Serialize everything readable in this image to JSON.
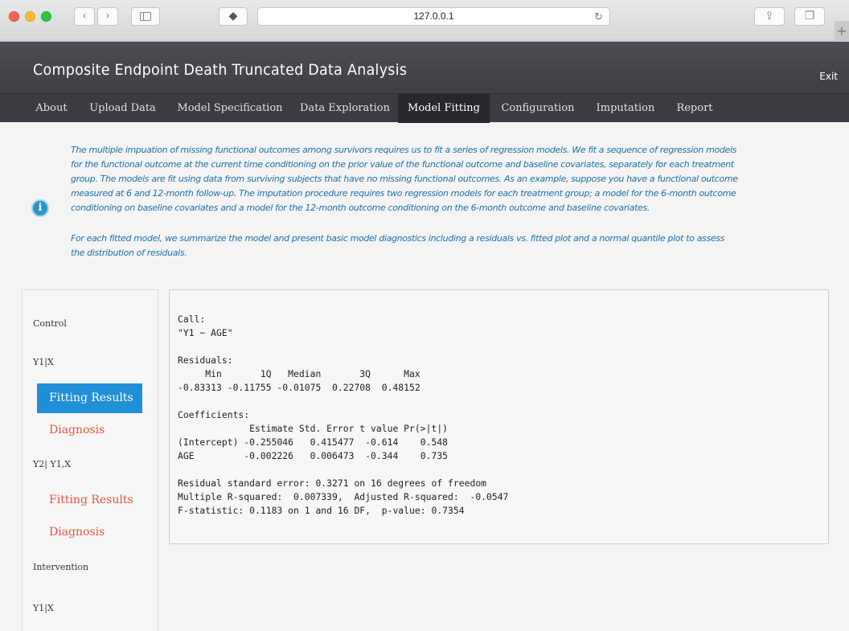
{
  "browser": {
    "url": "127.0.0.1"
  },
  "app": {
    "title": "Composite Endpoint Death Truncated Data Analysis",
    "exit_label": "Exit"
  },
  "nav": {
    "items": [
      {
        "label": "About"
      },
      {
        "label": "Upload Data"
      },
      {
        "label": "Model Specification"
      },
      {
        "label": "Data Exploration"
      },
      {
        "label": "Model Fitting",
        "active": true
      },
      {
        "label": "Configuration"
      },
      {
        "label": "Imputation"
      },
      {
        "label": "Report"
      }
    ]
  },
  "info": {
    "lines": [
      "The multiple impuation of missing functional outcomes among survivors requires us to fit a series of regression models. We fit a sequence of regression models",
      "for the functional outcome at the current time conditioning on the prior value of the functional outcome and baseline covariates, separately for each treatment",
      "group. The models are fit using data from surviving subjects that have no missing functional outcomes. As an example, suppose you have a functional outcome",
      "measured at 6 and 12-month follow-up. The imputation procedure requires two regression models for each treatment group; a model for the 6-month outcome",
      "conditioning on baseline covariates and a model for the 12-month outcome conditioning on the 6-month outcome and baseline covariates.",
      "For each fitted model, we summarize the model and present basic model diagnostics including a residuals vs. fitted plot and a normal quantile plot to assess",
      "the distribution of residuals."
    ]
  },
  "sidebar": {
    "control_label": "Control",
    "y1x_label": "Y1|X",
    "y1x_fitting": "Fitting Results",
    "y1x_diagnosis": "Diagnosis",
    "y2_label": "Y2| Y1,X",
    "y2_fitting": "Fitting Results",
    "y2_diagnosis": "Diagnosis",
    "intervention_label": "Intervention",
    "int_y1x_label": "Y1|X"
  },
  "output": {
    "lines": [
      "Call:",
      "\"Y1 ~ AGE\"",
      "",
      "Residuals:",
      "     Min       1Q   Median       3Q      Max ",
      "-0.83313 -0.11755 -0.01075  0.22708  0.48152 ",
      "",
      "Coefficients:",
      "             Estimate Std. Error t value Pr(>|t|)",
      "(Intercept) -0.255046   0.415477  -0.614    0.548",
      "AGE         -0.002226   0.006473  -0.344    0.735",
      "",
      "Residual standard error: 0.3271 on 16 degrees of freedom",
      "Multiple R-squared:  0.007339,  Adjusted R-squared:  -0.0547 ",
      "F-statistic: 0.1183 on 1 and 16 DF,  p-value: 0.7354"
    ]
  }
}
